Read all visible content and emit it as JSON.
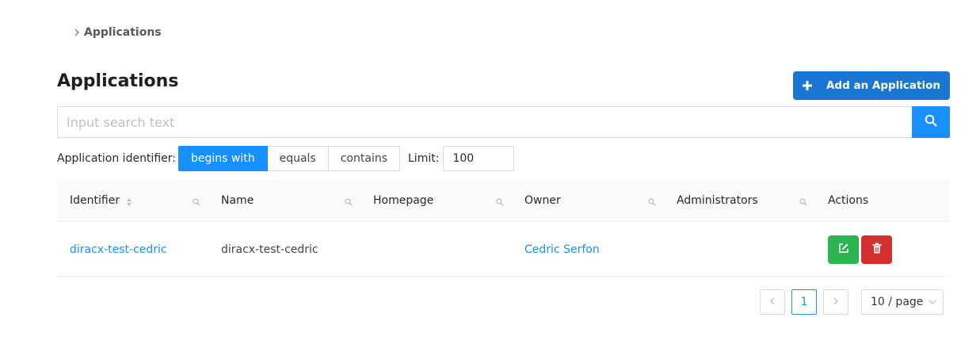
{
  "breadcrumb": {
    "items": [
      "Applications"
    ]
  },
  "page": {
    "title": "Applications"
  },
  "toolbar": {
    "add_label": "Add an Application"
  },
  "search": {
    "placeholder": "Input search text",
    "value": ""
  },
  "filter": {
    "label": "Application identifier:",
    "options": [
      "begins with",
      "equals",
      "contains"
    ],
    "selected": "begins with",
    "limit_label": "Limit:",
    "limit_value": "100"
  },
  "table": {
    "columns": [
      "Identifier",
      "Name",
      "Homepage",
      "Owner",
      "Administrators",
      "Actions"
    ],
    "rows": [
      {
        "identifier": "diracx-test-cedric",
        "name": "diracx-test-cedric",
        "homepage": "",
        "owner": "Cedric Serfon",
        "administrators": ""
      }
    ]
  },
  "pagination": {
    "current_page": "1",
    "page_size": "10 / page"
  },
  "colors": {
    "primary": "#1890ff",
    "add_button": "#1976d2",
    "edit": "#2db552",
    "delete": "#d32f2f"
  },
  "icons": [
    "chevron-right-icon",
    "plus-icon",
    "search-icon",
    "sort-icon",
    "filter-search-icon",
    "edit-icon",
    "trash-icon",
    "chevron-left-icon",
    "chevron-down-icon"
  ]
}
